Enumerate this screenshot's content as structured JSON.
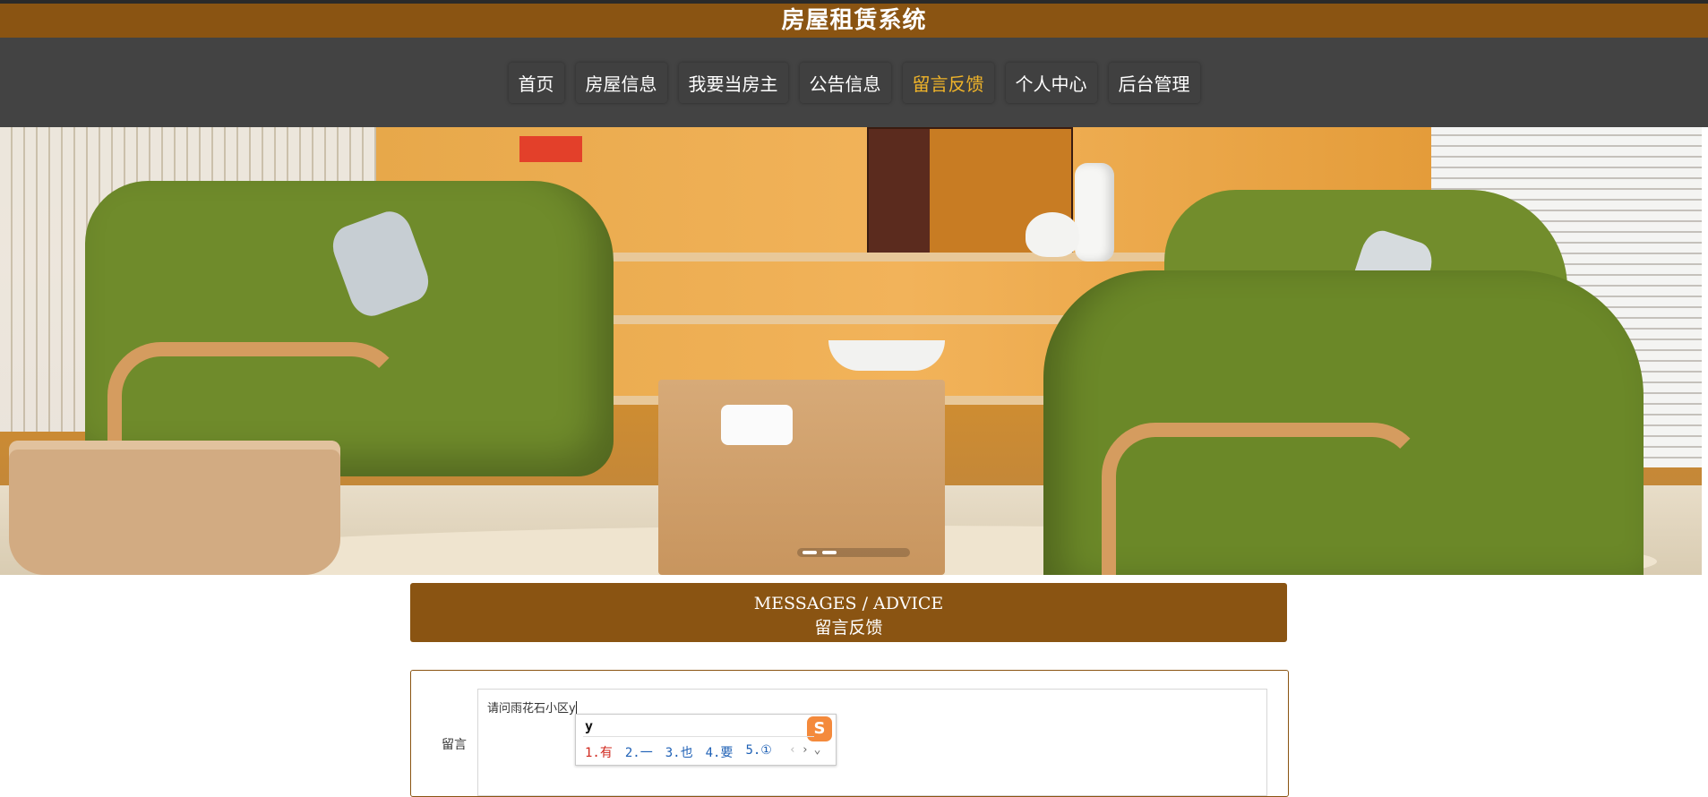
{
  "header": {
    "title": "房屋租赁系统"
  },
  "nav": {
    "items": [
      {
        "label": "首页"
      },
      {
        "label": "房屋信息"
      },
      {
        "label": "我要当房主"
      },
      {
        "label": "公告信息"
      },
      {
        "label": "留言反馈",
        "active": true
      },
      {
        "label": "个人中心"
      },
      {
        "label": "后台管理"
      }
    ]
  },
  "banner": {
    "image": "living-room-photo",
    "slide_indicator": "2 slides"
  },
  "section": {
    "title_en": "MESSAGES / ADVICE",
    "title_zh": "留言反馈"
  },
  "form": {
    "label": "留言",
    "value": "请问雨花石小区y"
  },
  "ime": {
    "input": "y",
    "logo": "S",
    "candidates": [
      "1.有",
      "2.一",
      "3.也",
      "4.要",
      "5.①"
    ],
    "nav_prev": "‹",
    "nav_next": "›",
    "nav_more": "⌄"
  },
  "colors": {
    "brand": "#8a5412",
    "nav_bg": "#434343",
    "active": "#f0b429"
  }
}
